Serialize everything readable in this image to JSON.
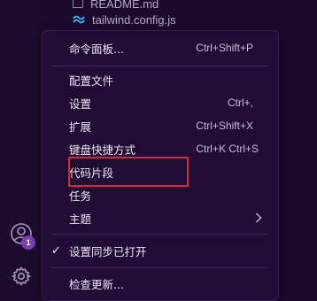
{
  "explorer": {
    "files": [
      {
        "name": "README.md",
        "icon": "markdown-icon"
      },
      {
        "name": "tailwind.config.js",
        "icon": "tailwind-icon"
      }
    ]
  },
  "activity_bar": {
    "accounts_badge": "1",
    "accounts_icon": "account-icon",
    "manage_icon": "gear-icon"
  },
  "menu": {
    "items": [
      {
        "label": "命令面板...",
        "shortcut": "Ctrl+Shift+P"
      },
      {
        "label": "配置文件",
        "shortcut": ""
      },
      {
        "label": "设置",
        "shortcut": "Ctrl+,"
      },
      {
        "label": "扩展",
        "shortcut": "Ctrl+Shift+X"
      },
      {
        "label": "键盘快捷方式",
        "shortcut": "Ctrl+K Ctrl+S"
      },
      {
        "label": "代码片段",
        "shortcut": ""
      },
      {
        "label": "任务",
        "shortcut": ""
      },
      {
        "label": "主题",
        "shortcut": "",
        "submenu": true
      },
      {
        "label": "设置同步已打开",
        "shortcut": "",
        "checked": true
      },
      {
        "label": "检查更新...",
        "shortcut": ""
      }
    ]
  },
  "colors": {
    "highlight": "#e0282e",
    "badge": "#7a3fb5",
    "menu_bg": "#210c36"
  }
}
